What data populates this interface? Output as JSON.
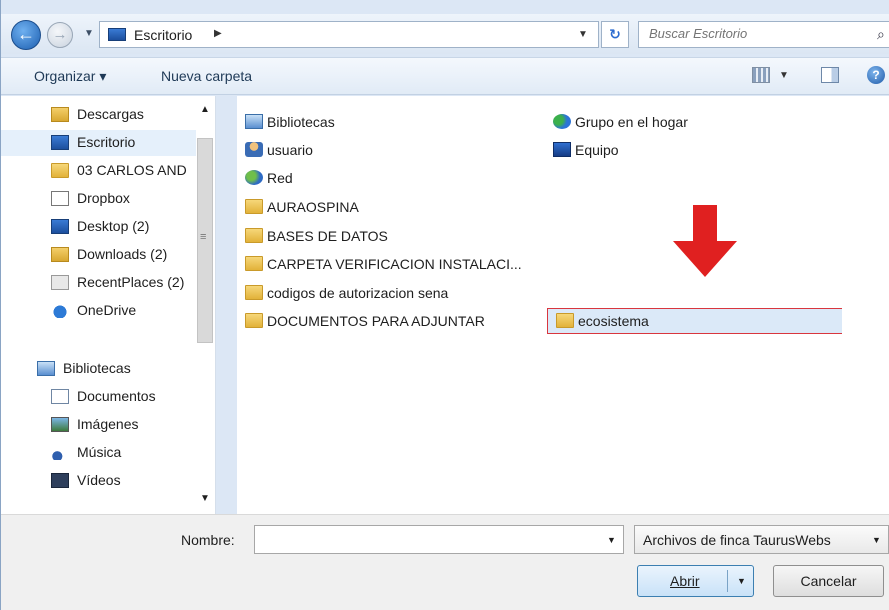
{
  "address_bar": {
    "crumb": "Escritorio",
    "search_placeholder": "Buscar Escritorio"
  },
  "toolbar": {
    "organize_label": "Organizar ▾",
    "new_folder_label": "Nueva carpeta"
  },
  "nav_pane": {
    "items": [
      {
        "label": "Descargas",
        "icon": "downloads-folder-icon"
      },
      {
        "label": "Escritorio",
        "icon": "desktop-icon",
        "selected": true
      },
      {
        "label": "03 CARLOS AND",
        "icon": "folder-icon"
      },
      {
        "label": "Dropbox",
        "icon": "dropbox-icon"
      },
      {
        "label": "Desktop (2)",
        "icon": "desktop-icon"
      },
      {
        "label": "Downloads (2)",
        "icon": "downloads-folder-icon"
      },
      {
        "label": "RecentPlaces (2)",
        "icon": "recent-places-icon"
      },
      {
        "label": "OneDrive",
        "icon": "onedrive-icon"
      },
      {
        "label": "Bibliotecas",
        "icon": "libraries-icon"
      },
      {
        "label": "Documentos",
        "icon": "documents-icon"
      },
      {
        "label": "Imágenes",
        "icon": "pictures-icon"
      },
      {
        "label": "Música",
        "icon": "music-icon"
      },
      {
        "label": "Vídeos",
        "icon": "videos-icon"
      }
    ]
  },
  "files": {
    "left_column": [
      {
        "label": "Bibliotecas",
        "icon": "libraries-icon"
      },
      {
        "label": "usuario",
        "icon": "user-icon"
      },
      {
        "label": "Red",
        "icon": "network-icon"
      },
      {
        "label": "AURAOSPINA",
        "icon": "folder-icon"
      },
      {
        "label": "BASES DE DATOS",
        "icon": "folder-icon"
      },
      {
        "label": "CARPETA VERIFICACION INSTALACI...",
        "icon": "folder-icon"
      },
      {
        "label": "codigos de autorizacion sena",
        "icon": "folder-icon"
      },
      {
        "label": "DOCUMENTOS PARA ADJUNTAR",
        "icon": "folder-icon"
      }
    ],
    "right_column": [
      {
        "label": "Grupo en el hogar",
        "icon": "homegroup-icon"
      },
      {
        "label": "Equipo",
        "icon": "computer-icon"
      },
      {
        "label": "ecosistema",
        "icon": "folder-icon",
        "selected": true
      }
    ]
  },
  "footer": {
    "name_label": "Nombre:",
    "name_value": "",
    "file_type": "Archivos de finca TaurusWebs",
    "open_label": "Abrir",
    "cancel_label": "Cancelar"
  },
  "colors": {
    "selection_border": "#d9363e",
    "arrow": "#e02020"
  }
}
